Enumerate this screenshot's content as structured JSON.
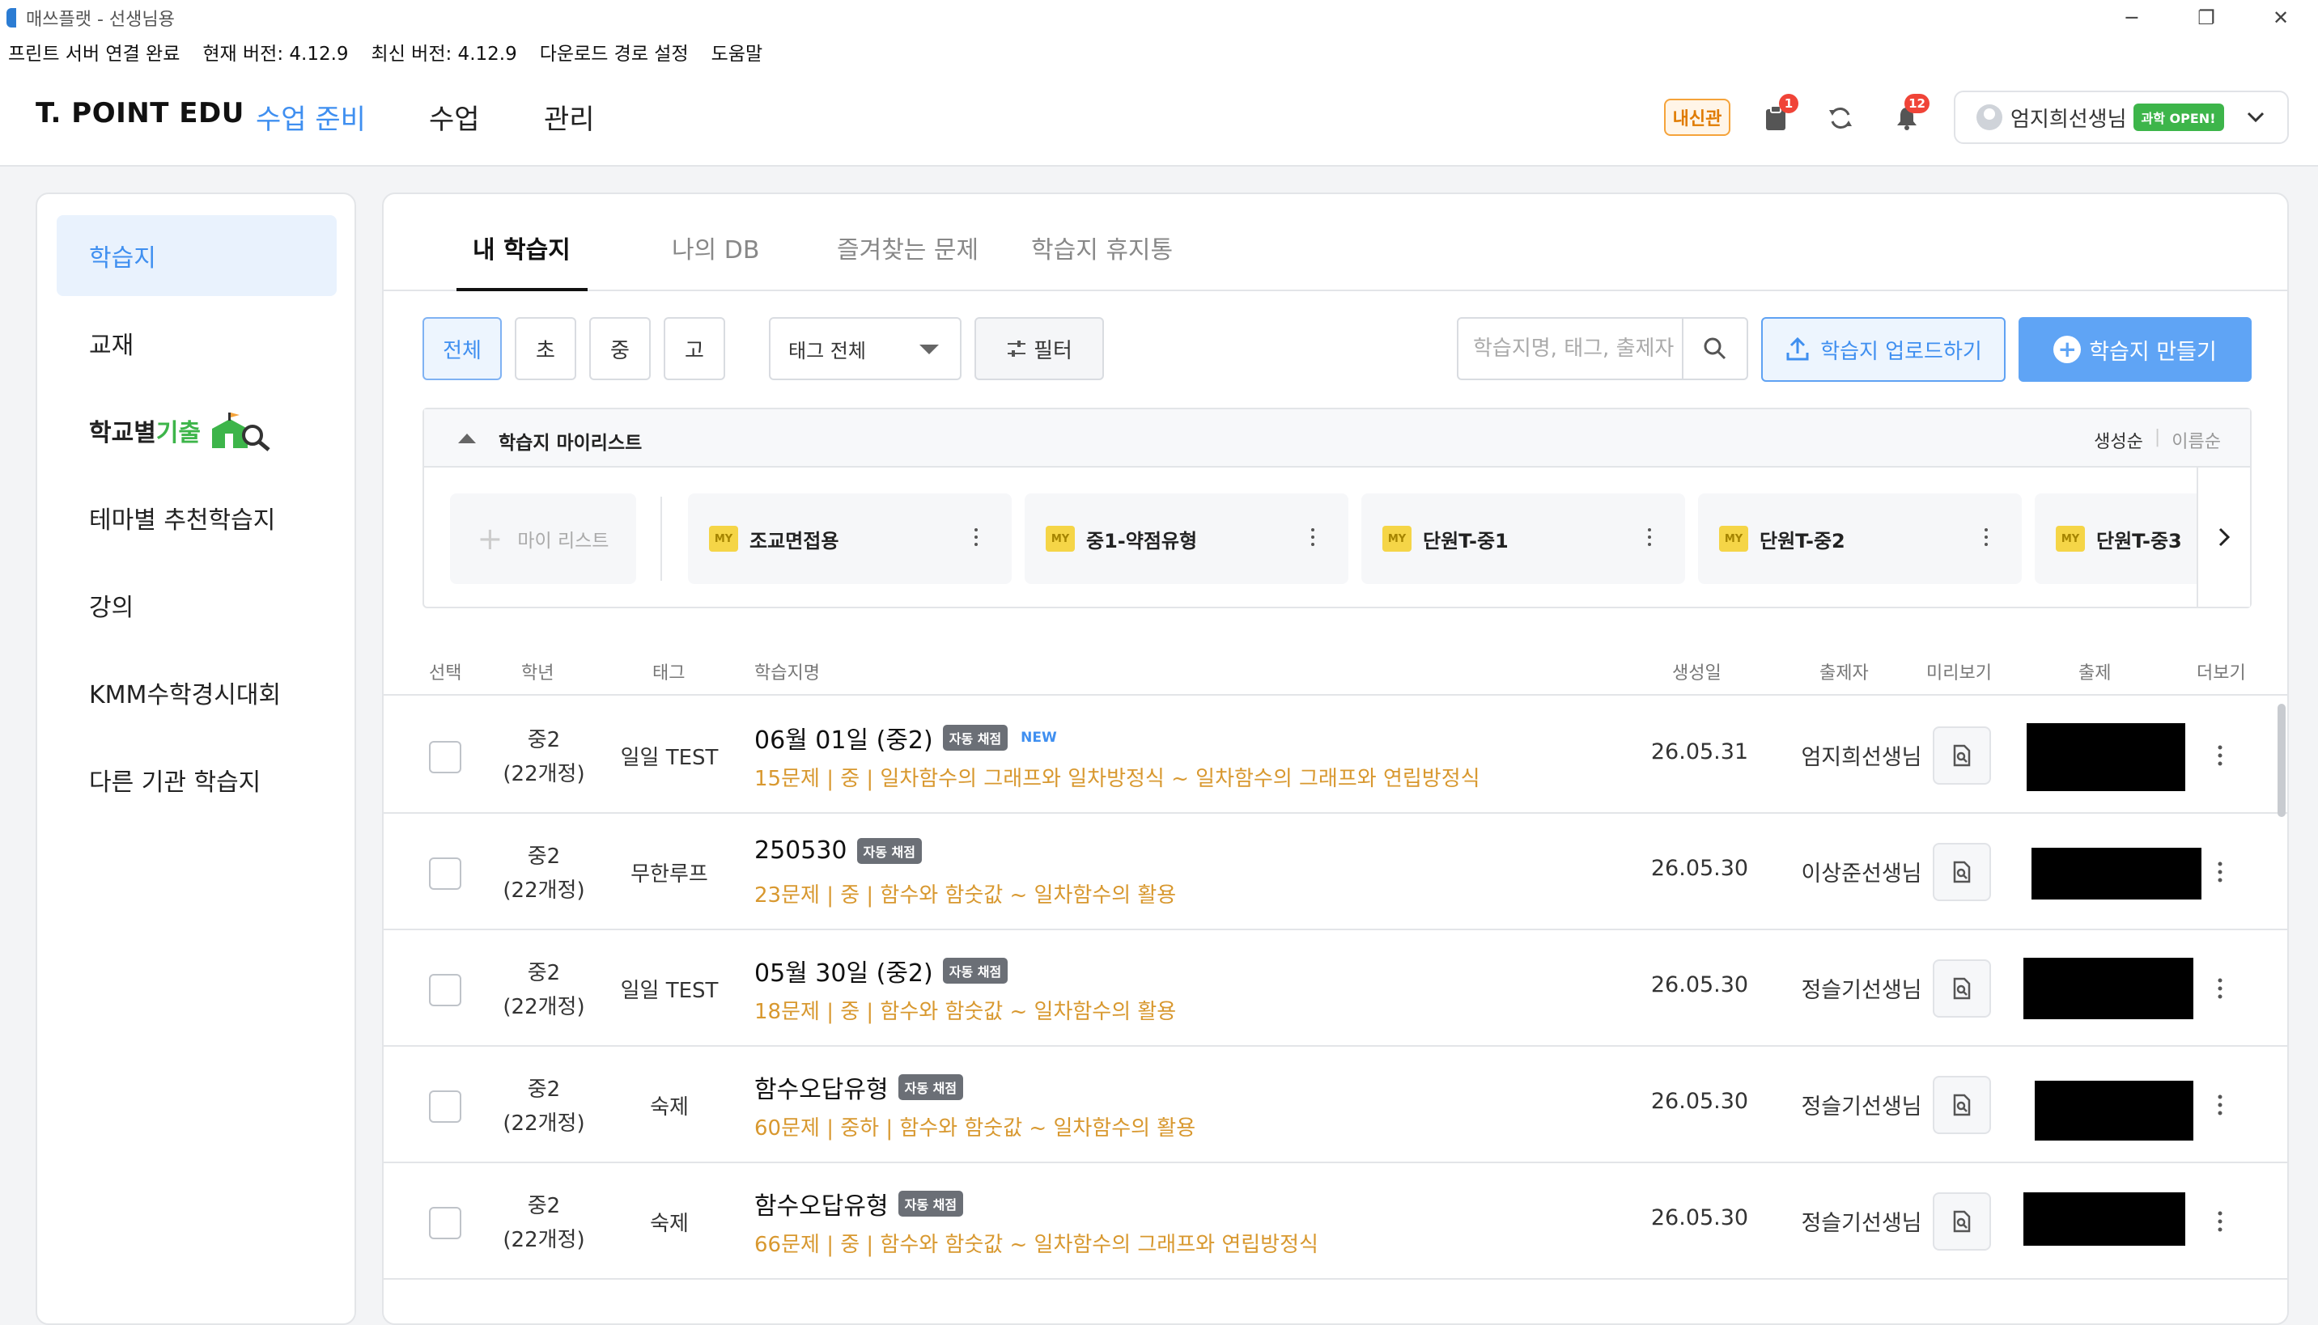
{
  "window": {
    "title": "매쓰플랫 - 선생님용",
    "controls": [
      "minimize",
      "restore",
      "close"
    ]
  },
  "statusbar": {
    "print_server": "프린트 서버 연결 완료",
    "current_version": "현재 버전: 4.12.9",
    "latest_version": "최신 버전: 4.12.9",
    "download_path": "다운로드 경로 설정",
    "help": "도움말"
  },
  "header": {
    "logo": "T. POINT EDU",
    "nav": [
      "수업 준비",
      "수업",
      "관리"
    ],
    "active_nav": "수업 준비",
    "naesin_badge": "내신관",
    "clipboard_count": "1",
    "bell_count": "12",
    "user_name": "엄지희선생님",
    "user_tag": "과학 OPEN!"
  },
  "sidebar": {
    "items": [
      {
        "label": "학습지",
        "active": true
      },
      {
        "label": "교재"
      },
      {
        "label": "학교별",
        "label_accent": "기출"
      },
      {
        "label": "테마별 추천학습지"
      },
      {
        "label": "강의"
      },
      {
        "label": "KMM수학경시대회"
      },
      {
        "label": "다른 기관 학습지"
      }
    ]
  },
  "main": {
    "tabs": [
      "내 학습지",
      "나의 DB",
      "즐겨찾는 문제",
      "학습지 휴지통"
    ],
    "active_tab": "내 학습지",
    "grade_filters": [
      "전체",
      "초",
      "중",
      "고"
    ],
    "active_grade": "전체",
    "tag_select": "태그 전체",
    "filter_label": "필터",
    "search_placeholder": "학습지명, 태그, 출제자",
    "upload_label": "학습지 업로드하기",
    "create_label": "학습지 만들기"
  },
  "mylist": {
    "title": "학습지 마이리스트",
    "sort": [
      "생성순",
      "이름순"
    ],
    "active_sort": "생성순",
    "add_label": "마이 리스트",
    "badge": "MY",
    "lists": [
      "조교면접용",
      "중1-약점유형",
      "단원T-중1",
      "단원T-중2",
      "단원T-중3"
    ]
  },
  "table": {
    "headers": [
      "선택",
      "학년",
      "태그",
      "학습지명",
      "생성일",
      "출제자",
      "미리보기",
      "출제",
      "더보기"
    ],
    "auto_badge": "자동 채점",
    "new_badge": "NEW",
    "rows": [
      {
        "grade": "중2",
        "curriculum": "(22개정)",
        "tag": "일일 TEST",
        "title": "06월 01일 (중2)",
        "is_new": true,
        "detail": "15문제 | 중 | 일차함수의 그래프와 일차방정식 ~ 일차함수의 그래프와 연립방정식",
        "date": "26.05.31",
        "author": "엄지희선생님"
      },
      {
        "grade": "중2",
        "curriculum": "(22개정)",
        "tag": "무한루프",
        "title": "250530",
        "is_new": false,
        "detail": "23문제 | 중 | 함수와 함숫값 ~ 일차함수의 활용",
        "date": "26.05.30",
        "author": "이상준선생님"
      },
      {
        "grade": "중2",
        "curriculum": "(22개정)",
        "tag": "일일 TEST",
        "title": "05월 30일 (중2)",
        "is_new": false,
        "detail": "18문제 | 중 | 함수와 함숫값 ~ 일차함수의 활용",
        "date": "26.05.30",
        "author": "정슬기선생님"
      },
      {
        "grade": "중2",
        "curriculum": "(22개정)",
        "tag": "숙제",
        "title": "함수오답유형",
        "is_new": false,
        "detail": "60문제 | 중하 | 함수와 함숫값 ~ 일차함수의 활용",
        "date": "26.05.30",
        "author": "정슬기선생님"
      },
      {
        "grade": "중2",
        "curriculum": "(22개정)",
        "tag": "숙제",
        "title": "함수오답유형",
        "is_new": false,
        "detail": "66문제 | 중 | 함수와 함숫값 ~ 일차함수의 그래프와 연립방정식",
        "date": "26.05.30",
        "author": "정슬기선생님"
      }
    ]
  },
  "colors": {
    "accent": "#3f8ff0",
    "detail_text": "#d8982f",
    "notif": "#f04438",
    "green": "#3db54a"
  }
}
